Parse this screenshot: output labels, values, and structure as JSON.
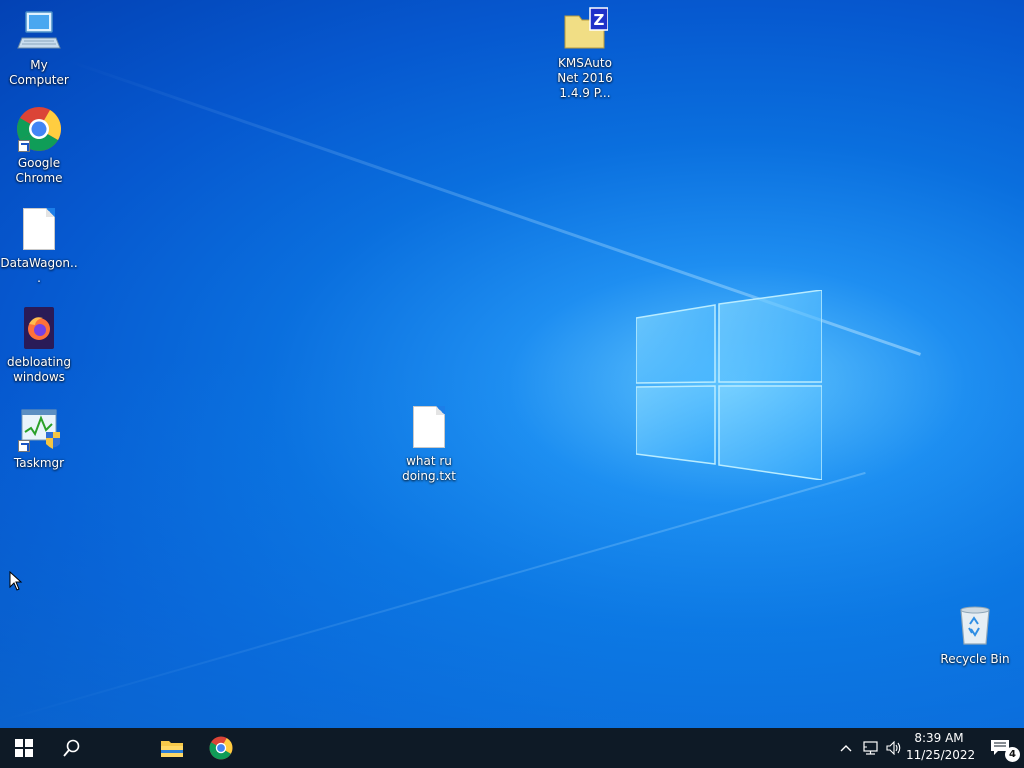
{
  "desktop": {
    "icons": [
      {
        "name": "my-computer",
        "label": "My Computer"
      },
      {
        "name": "google-chrome",
        "label": "Google Chrome"
      },
      {
        "name": "datawagon",
        "label": "DataWagon..."
      },
      {
        "name": "debloating-windows",
        "label": "debloating windows"
      },
      {
        "name": "taskmgr",
        "label": "Taskmgr"
      },
      {
        "name": "kmsauto",
        "label": "KMSAuto Net 2016 1.4.9 P..."
      },
      {
        "name": "what-ru-doing",
        "label": "what ru doing.txt"
      },
      {
        "name": "recycle-bin",
        "label": "Recycle Bin"
      }
    ]
  },
  "icons_glyphs": {
    "kms_letter": "Z"
  },
  "taskbar": {
    "start_icon": "windows-start-icon",
    "search_icon": "search-icon",
    "pinned": [
      "file-explorer-icon",
      "chrome-icon"
    ],
    "tray": {
      "chevron": "^",
      "time": "8:39 AM",
      "date": "11/25/2022",
      "notification_count": "4"
    }
  },
  "colors": {
    "taskbar_bg": "#0e1a26",
    "wallpaper_accent": "#0a6fde"
  }
}
